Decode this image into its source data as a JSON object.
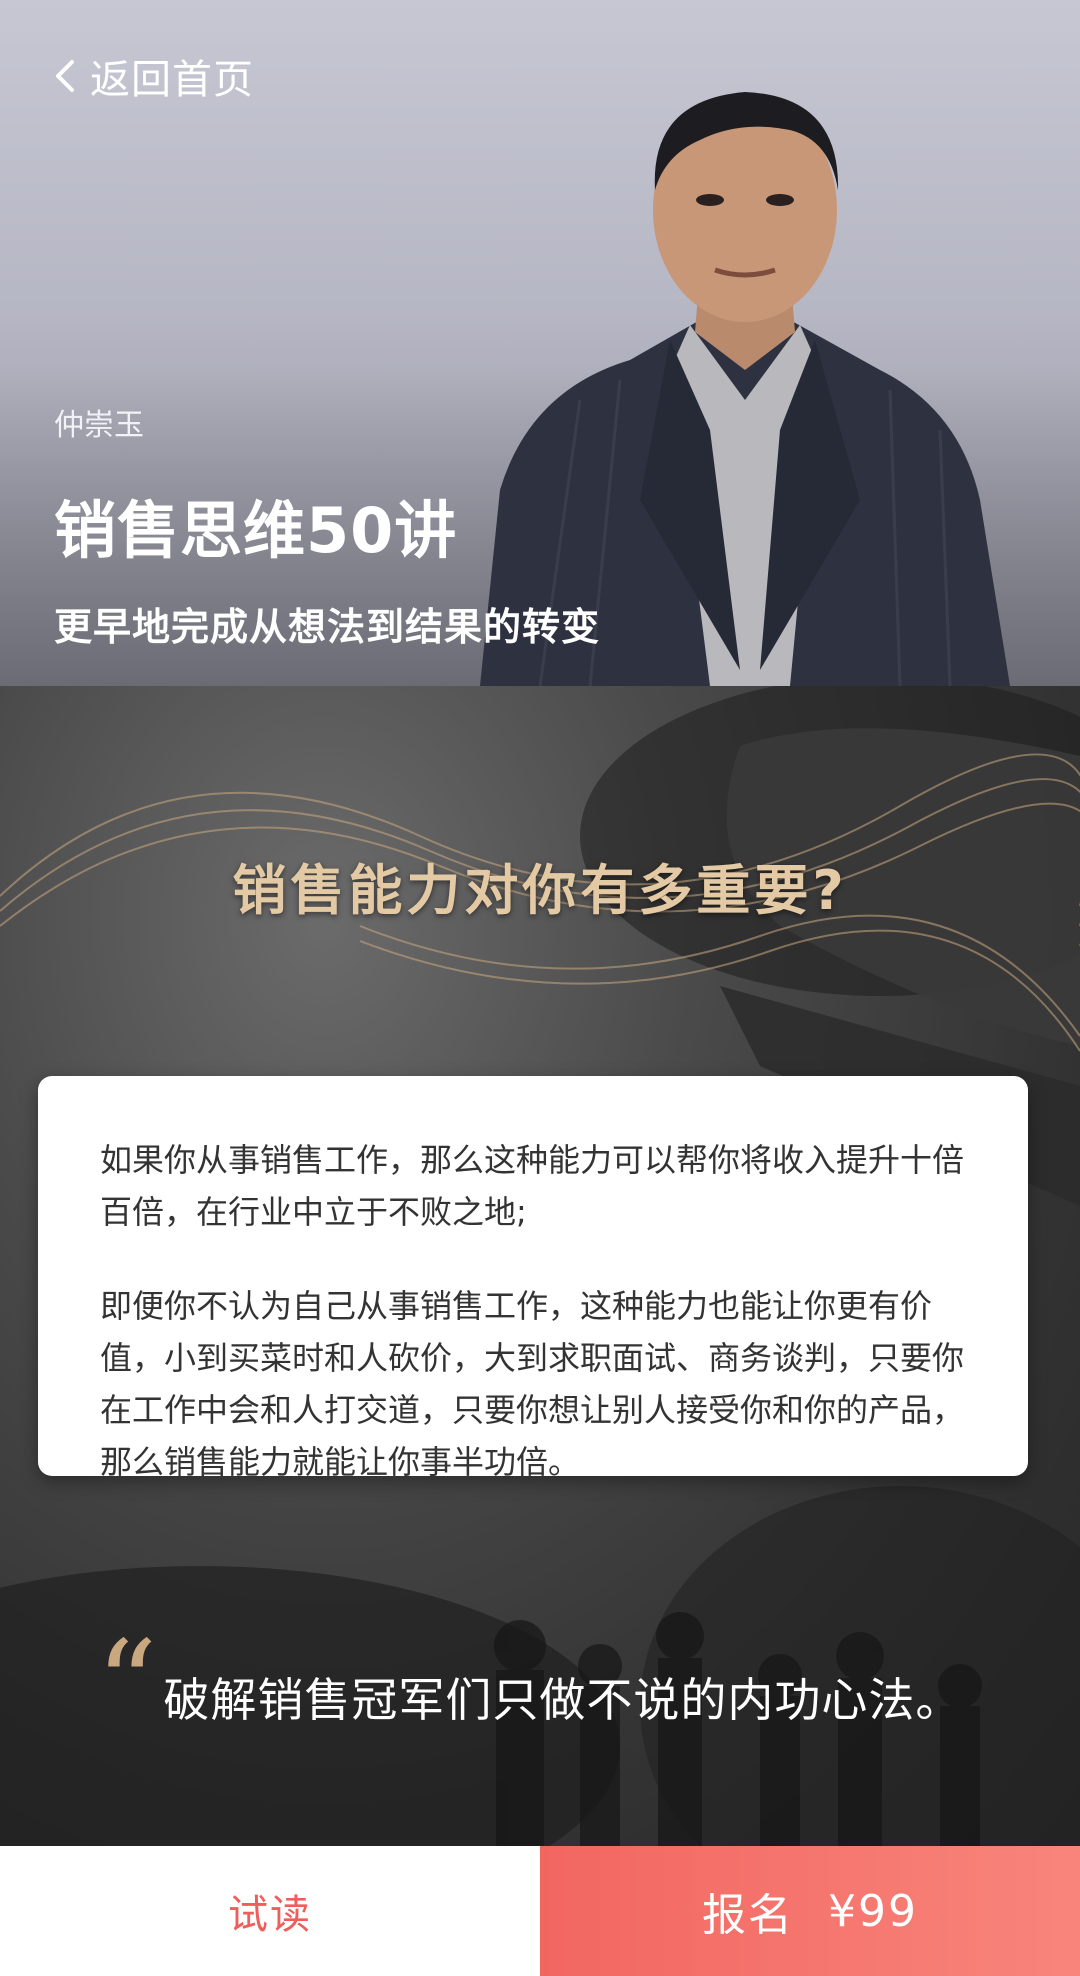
{
  "nav": {
    "back_label": "返回首页",
    "back_icon": "chevron-left-icon"
  },
  "hero": {
    "author": "仲崇玉",
    "title": "销售思维50讲",
    "subtitle": "更早地完成从想法到结果的转变",
    "background_color": "#c6c7d3"
  },
  "poster": {
    "question": "销售能力对你有多重要?",
    "question_color": "#e3c9a4",
    "paragraphs": [
      "如果你从事销售工作，那么这种能力可以帮你将收入提升十倍百倍，在行业中立于不败之地;",
      "即便你不认为自己从事销售工作，这种能力也能让你更有价值，小到买菜时和人砍价，大到求职面试、商务谈判，只要你在工作中会和人打交道，只要你想让别人接受你和你的产品，那么销售能力就能让你事半功倍。"
    ],
    "quote_mark": "“",
    "quote": "破解销售冠军们只做不说的内功心法。"
  },
  "footer": {
    "trial_label": "试读",
    "enroll_label": "报名",
    "price": "¥99",
    "trial_color": "#ef5e5a",
    "enroll_color": "#f26660"
  }
}
